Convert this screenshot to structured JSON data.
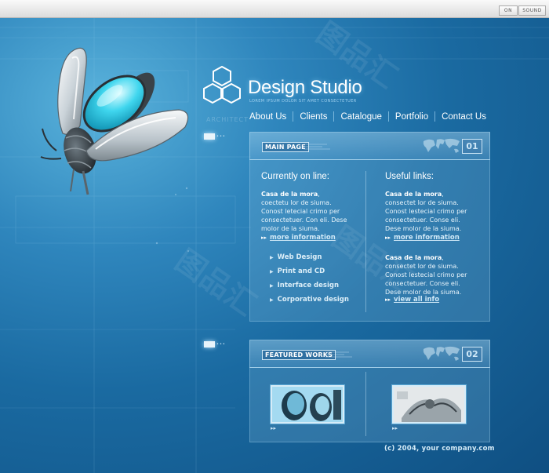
{
  "topbar": {
    "on_label": "ON",
    "sound_label": "SOUND"
  },
  "brand": {
    "name": "Design Studio",
    "tagline": "LOREM IPSUM DOLOR SIT AMET CONSECTETUER",
    "deco_word": "ARCHITECT"
  },
  "nav": [
    "About Us",
    "Clients",
    "Catalogue",
    "Portfolio",
    "Contact Us"
  ],
  "main_panel": {
    "tag": "MAIN PAGE",
    "number": "01",
    "left": {
      "title": "Currently on line:",
      "strong": "Casa de la mora",
      "text": ", coectetu lor de siuma. Conost letecial crimo per consectetuer. Con eli. Dese molor de la siuma.",
      "more": "more information",
      "services": [
        "Web Design",
        "Print and CD",
        "Interface design",
        "Corporative design"
      ]
    },
    "right": {
      "title": "Useful links:",
      "block1_strong": "Casa de la mora",
      "block1_text": ", consectet lor de siuma. Conost lestecial crimo per consectetuer. Conse eli. Dese molor de la siuma.",
      "more": "more information",
      "block2_strong": "Casa de la mora",
      "block2_text": ", consectet lor de siuma. Conost lestecial crimo per consectetuer. Conse eli. Dese molor de la siuma.",
      "view_all": "view all info"
    }
  },
  "featured_panel": {
    "tag": "FEATURED WORKS",
    "number": "02"
  },
  "footer": "(c) 2004, your company.com",
  "watermark": "图品汇",
  "colors": {
    "background": "#1e6aa0",
    "accent": "#cfe8f7",
    "glass": "#4fd8ef"
  },
  "icons": {
    "hexagon_logo": "hexagon-logo-icon",
    "world_map": "world-map-icon",
    "arrow": "double-arrow-icon",
    "triangle": "triangle-bullet-icon"
  }
}
